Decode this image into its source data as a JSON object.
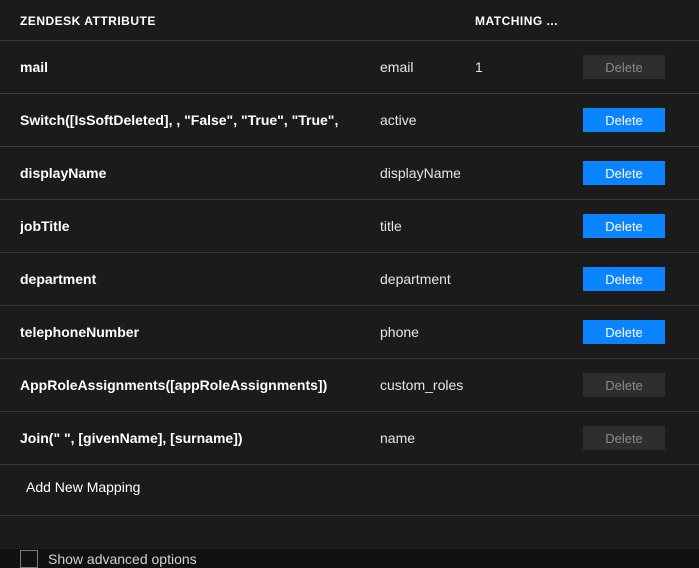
{
  "headers": {
    "zendesk_attribute": "ZENDESK ATTRIBUTE",
    "matching": "MATCHING ..."
  },
  "rows": [
    {
      "attr": "mail",
      "zattr": "email",
      "match": "1",
      "action": "Delete",
      "enabled": false
    },
    {
      "attr": "Switch([IsSoftDeleted], , \"False\", \"True\", \"True\",",
      "zattr": "active",
      "match": "",
      "action": "Delete",
      "enabled": true
    },
    {
      "attr": "displayName",
      "zattr": "displayName",
      "match": "",
      "action": "Delete",
      "enabled": true
    },
    {
      "attr": "jobTitle",
      "zattr": "title",
      "match": "",
      "action": "Delete",
      "enabled": true
    },
    {
      "attr": "department",
      "zattr": "department",
      "match": "",
      "action": "Delete",
      "enabled": true
    },
    {
      "attr": "telephoneNumber",
      "zattr": "phone",
      "match": "",
      "action": "Delete",
      "enabled": true
    },
    {
      "attr": "AppRoleAssignments([appRoleAssignments])",
      "zattr": "custom_roles",
      "match": "",
      "action": "Delete",
      "enabled": false
    },
    {
      "attr": "Join(\" \", [givenName], [surname])",
      "zattr": "name",
      "match": "",
      "action": "Delete",
      "enabled": false
    }
  ],
  "add_mapping_label": "Add New Mapping",
  "advanced_label": "Show advanced options"
}
